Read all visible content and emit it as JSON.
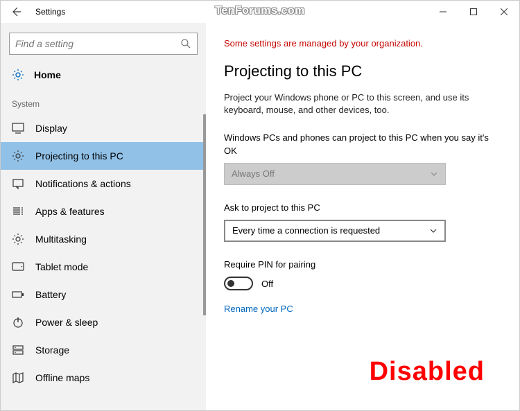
{
  "window": {
    "title": "Settings",
    "watermark": "TenForums.com"
  },
  "search": {
    "placeholder": "Find a setting"
  },
  "home_label": "Home",
  "section_label": "System",
  "nav": [
    {
      "label": "Display",
      "icon": "display-icon"
    },
    {
      "label": "Projecting to this PC",
      "icon": "gear-icon"
    },
    {
      "label": "Notifications & actions",
      "icon": "notifications-icon"
    },
    {
      "label": "Apps & features",
      "icon": "apps-icon"
    },
    {
      "label": "Multitasking",
      "icon": "multitasking-icon"
    },
    {
      "label": "Tablet mode",
      "icon": "tablet-icon"
    },
    {
      "label": "Battery",
      "icon": "battery-icon"
    },
    {
      "label": "Power & sleep",
      "icon": "power-icon"
    },
    {
      "label": "Storage",
      "icon": "storage-icon"
    },
    {
      "label": "Offline maps",
      "icon": "maps-icon"
    }
  ],
  "main": {
    "org_notice": "Some settings are managed by your organization.",
    "heading": "Projecting to this PC",
    "description": "Project your Windows phone or PC to this screen, and use its keyboard, mouse, and other devices, too.",
    "field1_label": "Windows PCs and phones can project to this PC when you say it's OK",
    "field1_value": "Always Off",
    "field2_label": "Ask to project to this PC",
    "field2_value": "Every time a connection is requested",
    "field3_label": "Require PIN for pairing",
    "toggle_state": "Off",
    "link_label": "Rename your PC",
    "stamp": "Disabled"
  }
}
